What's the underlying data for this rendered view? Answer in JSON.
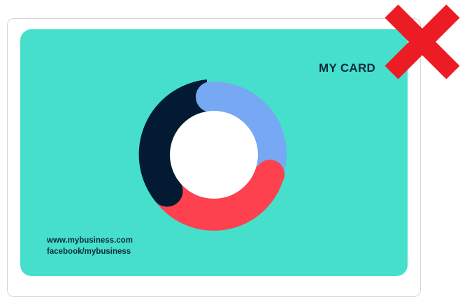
{
  "card": {
    "title": "MY CARD",
    "contact": {
      "website": "www.mybusiness.com",
      "facebook": "facebook/mybusiness"
    }
  },
  "colors": {
    "card_background": "#45DFCB",
    "text": "#0E2A3D",
    "ring_navy": "#021B33",
    "ring_blue": "#76A8F3",
    "ring_red": "#FD414E",
    "center": "#FFFFFF",
    "reject_mark": "#EC1C24"
  },
  "icons": {
    "logo": "donut-ring-logo-icon",
    "reject": "red-x-icon"
  }
}
